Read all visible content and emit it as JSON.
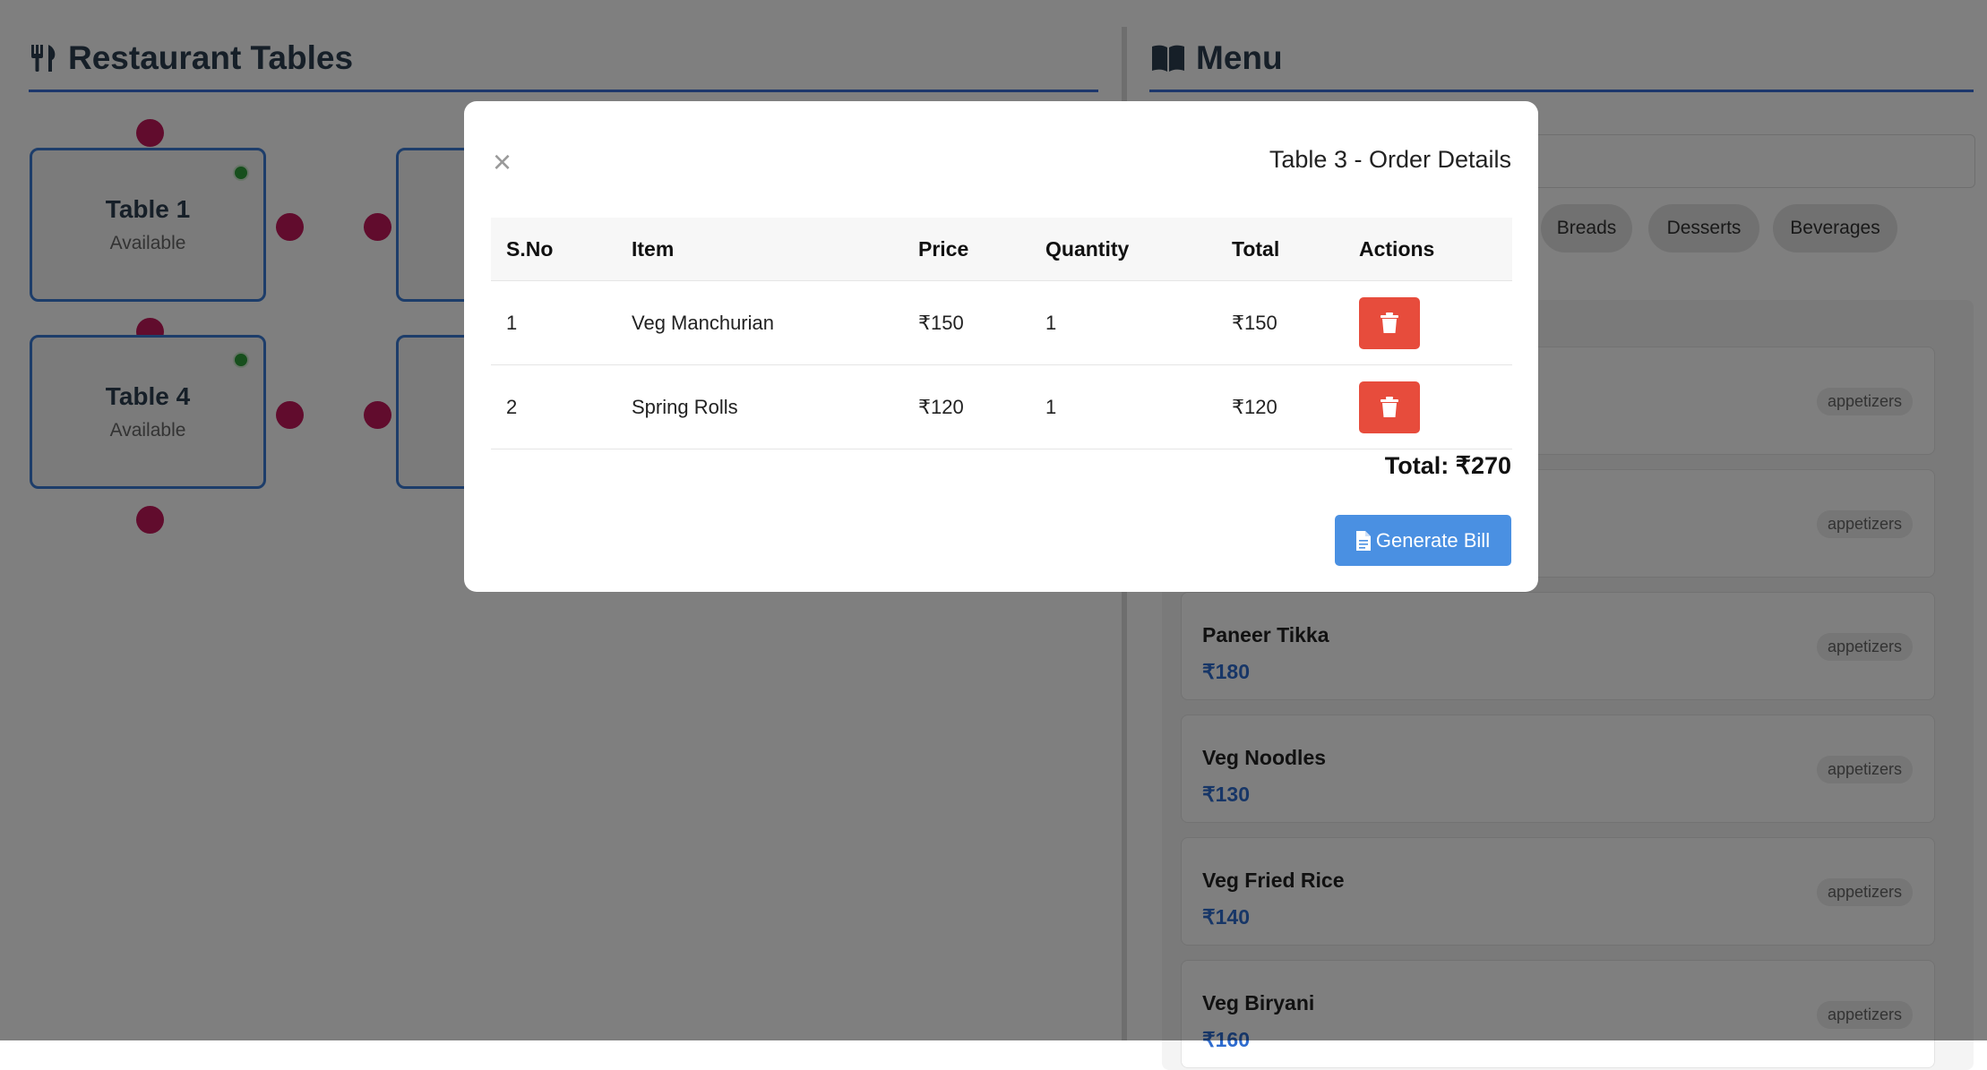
{
  "left_panel": {
    "title": "Restaurant Tables",
    "icon": "utensils-icon"
  },
  "tables": [
    {
      "name": "Table 1",
      "status": "Available"
    },
    {
      "name": "Table 4",
      "status": "Available"
    }
  ],
  "right_panel": {
    "title": "Menu",
    "icon": "book-open-icon",
    "categories": [
      "Breads",
      "Desserts",
      "Beverages"
    ],
    "items": [
      {
        "name": "Paneer Tikka",
        "price": "₹180",
        "tag": "appetizers"
      },
      {
        "name": "Veg Noodles",
        "price": "₹130",
        "tag": "appetizers"
      },
      {
        "name": "Veg Fried Rice",
        "price": "₹140",
        "tag": "appetizers"
      },
      {
        "name": "Veg Biryani",
        "price": "₹160",
        "tag": "appetizers"
      }
    ],
    "hidden_item_tags": [
      "appetizers",
      "appetizers"
    ]
  },
  "modal": {
    "close_label": "×",
    "title": "Table 3 - Order Details",
    "headers": [
      "S.No",
      "Item",
      "Price",
      "Quantity",
      "Total",
      "Actions"
    ],
    "rows": [
      {
        "sno": "1",
        "item": "Veg Manchurian",
        "price": "₹150",
        "qty": "1",
        "total": "₹150"
      },
      {
        "sno": "2",
        "item": "Spring Rolls",
        "price": "₹120",
        "qty": "1",
        "total": "₹120"
      }
    ],
    "total": "Total: ₹270",
    "generate_label": "Generate Bill"
  },
  "colors": {
    "accent": "#3a6fd8",
    "table_border": "#3a7bd5",
    "chair": "#c2185b",
    "available_dot": "#2e9e3a",
    "delete": "#e74c3c",
    "primary_button": "#4a90e2",
    "price": "#2f6ccf"
  }
}
